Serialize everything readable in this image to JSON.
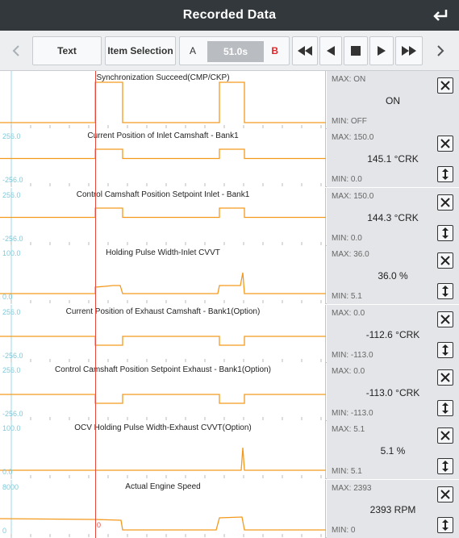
{
  "header": {
    "title": "Recorded Data",
    "back_icon": "return-arrow-icon"
  },
  "toolbar": {
    "prev_icon": "chevron-left-icon",
    "text_label": "Text",
    "item_selection_label": "Item Selection",
    "a_label": "A",
    "time": "51.0s",
    "b_label": "B",
    "fast_back_icon": "fast-rewind-icon",
    "back_icon": "play-back-icon",
    "stop_icon": "stop-icon",
    "play_icon": "play-icon",
    "fast_forward_icon": "fast-forward-icon",
    "next_icon": "chevron-right-icon"
  },
  "colors": {
    "header_bg": "#33383c",
    "trace": "#f39a1e",
    "cursor": "#e8483c",
    "axis_label": "#7fc9d9",
    "panel_bg": "#e3e5e8"
  },
  "rows": [
    {
      "title": "Synchronization Succeed(CMP/CKP)",
      "ymax": "",
      "ymin": "",
      "max": "MAX: ON",
      "value": "ON",
      "min": "MIN: OFF",
      "trace": [
        [
          0,
          0
        ],
        [
          118,
          0
        ],
        [
          118,
          1
        ],
        [
          152,
          1
        ],
        [
          152,
          0
        ],
        [
          272,
          0
        ],
        [
          272,
          1
        ],
        [
          303,
          1
        ],
        [
          303,
          0
        ],
        [
          404,
          0
        ]
      ],
      "scale_button": false
    },
    {
      "title": "Current Position of Inlet Camshaft - Bank1",
      "ymax": "256.0",
      "ymin": "-256.0",
      "max": "MAX: 150.0",
      "value": "145.1 °CRK",
      "min": "MIN: 0.0",
      "trace": [
        [
          0,
          0.55
        ],
        [
          118,
          0.55
        ],
        [
          118,
          0.78
        ],
        [
          152,
          0.78
        ],
        [
          152,
          0.55
        ],
        [
          272,
          0.55
        ],
        [
          272,
          0.78
        ],
        [
          303,
          0.78
        ],
        [
          303,
          0.55
        ],
        [
          404,
          0.55
        ]
      ],
      "scale_button": true
    },
    {
      "title": "Control Camshaft Position Setpoint Inlet - Bank1",
      "ymax": "256.0",
      "ymin": "-256.0",
      "max": "MAX: 150.0",
      "value": "144.3 °CRK",
      "min": "MIN: 0.0",
      "trace": [
        [
          0,
          0.55
        ],
        [
          118,
          0.55
        ],
        [
          118,
          0.78
        ],
        [
          152,
          0.78
        ],
        [
          152,
          0.55
        ],
        [
          272,
          0.55
        ],
        [
          272,
          0.78
        ],
        [
          303,
          0.78
        ],
        [
          303,
          0.55
        ],
        [
          404,
          0.55
        ]
      ],
      "scale_button": true
    },
    {
      "title": "Holding Pulse Width-Inlet CVVT",
      "ymax": "100.0",
      "ymin": "0.0",
      "max": "MAX: 36.0",
      "value": "36.0 %",
      "min": "MIN: 5.1",
      "trace": [
        [
          0,
          0.1
        ],
        [
          118,
          0.1
        ],
        [
          118,
          0.26
        ],
        [
          130,
          0.28
        ],
        [
          140,
          0.3
        ],
        [
          149,
          0.3
        ],
        [
          152,
          0.1
        ],
        [
          270,
          0.1
        ],
        [
          272,
          0.3
        ],
        [
          298,
          0.3
        ],
        [
          301,
          0.62
        ],
        [
          303,
          0.1
        ],
        [
          404,
          0.1
        ]
      ],
      "scale_button": true
    },
    {
      "title": "Current Position of Exhaust Camshaft - Bank1(Option)",
      "ymax": "256.0",
      "ymin": "-256.0",
      "max": "MAX: 0.0",
      "value": "-112.6 °CRK",
      "min": "MIN: -113.0",
      "trace": [
        [
          0,
          0.5
        ],
        [
          118,
          0.5
        ],
        [
          118,
          0.28
        ],
        [
          152,
          0.28
        ],
        [
          152,
          0.5
        ],
        [
          272,
          0.5
        ],
        [
          272,
          0.28
        ],
        [
          303,
          0.28
        ],
        [
          303,
          0.5
        ],
        [
          404,
          0.5
        ]
      ],
      "scale_button": true
    },
    {
      "title": "Control Camshaft Position Setpoint Exhaust - Bank1(Option)",
      "ymax": "256.0",
      "ymin": "-256.0",
      "max": "MAX: 0.0",
      "value": "-113.0 °CRK",
      "min": "MIN: -113.0",
      "trace": [
        [
          0,
          0.5
        ],
        [
          118,
          0.5
        ],
        [
          118,
          0.28
        ],
        [
          152,
          0.28
        ],
        [
          152,
          0.5
        ],
        [
          272,
          0.5
        ],
        [
          272,
          0.28
        ],
        [
          303,
          0.28
        ],
        [
          303,
          0.5
        ],
        [
          404,
          0.5
        ]
      ],
      "scale_button": true
    },
    {
      "title": "OCV Holding Pulse Width-Exhaust CVVT(Option)",
      "ymax": "100.0",
      "ymin": "0.0",
      "max": "MAX: 5.1",
      "value": "5.1 %",
      "min": "MIN: 5.1",
      "trace": [
        [
          0,
          0.06
        ],
        [
          299,
          0.06
        ],
        [
          301,
          0.62
        ],
        [
          303,
          0.06
        ],
        [
          404,
          0.06
        ]
      ],
      "scale_button": true
    },
    {
      "title": "Actual Engine Speed",
      "ymax": "8000",
      "ymin": "0",
      "max": "MAX: 2393",
      "value": "2393 RPM",
      "min": "MIN: 0",
      "trace": [
        [
          0,
          0.32
        ],
        [
          118,
          0.3
        ],
        [
          150,
          0.28
        ],
        [
          152,
          0.04
        ],
        [
          268,
          0.04
        ],
        [
          272,
          0.34
        ],
        [
          300,
          0.36
        ],
        [
          303,
          0.04
        ],
        [
          404,
          0.04
        ]
      ],
      "scale_button": true
    }
  ],
  "cursor_label": "0"
}
